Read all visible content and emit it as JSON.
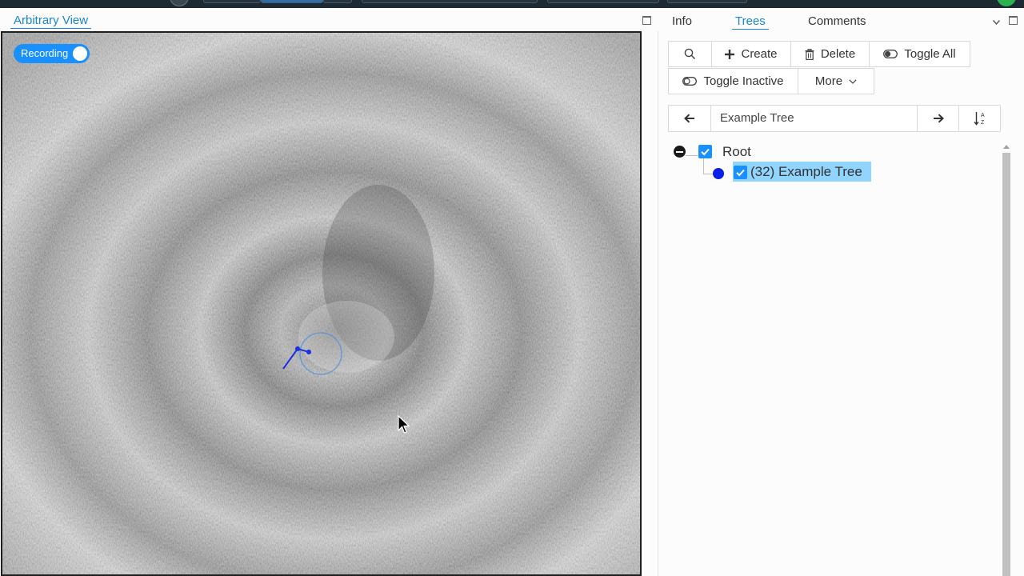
{
  "left_pane": {
    "view_tab_label": "Arbitrary View",
    "recording_label": "Recording"
  },
  "right_pane": {
    "tabs": [
      {
        "label": "Info"
      },
      {
        "label": "Trees"
      },
      {
        "label": "Comments"
      }
    ],
    "active_tab": "Trees",
    "toolbar": {
      "create_label": "Create",
      "delete_label": "Delete",
      "toggle_all_label": "Toggle All",
      "toggle_inactive_label": "Toggle Inactive",
      "more_label": "More"
    },
    "tree_nav": {
      "active_tree_name": "Example Tree"
    },
    "tree": {
      "root_label": "Root",
      "child_label": "(32) Example Tree"
    }
  },
  "colors": {
    "accent": "#1890ff",
    "tab_active": "#1a86d0",
    "selected_row": "#91d5ff",
    "node_color": "#0a1ee8",
    "topbar": "#1e2a33"
  },
  "icons": {
    "search": "search-icon",
    "create": "plus-icon",
    "delete": "trash-icon",
    "toggle_all": "toggle-icon",
    "toggle_inactive": "toggle-off-icon",
    "more": "chevron-down-icon",
    "prev": "arrow-left-icon",
    "next": "arrow-right-icon",
    "sort": "sort-alpha-icon"
  }
}
